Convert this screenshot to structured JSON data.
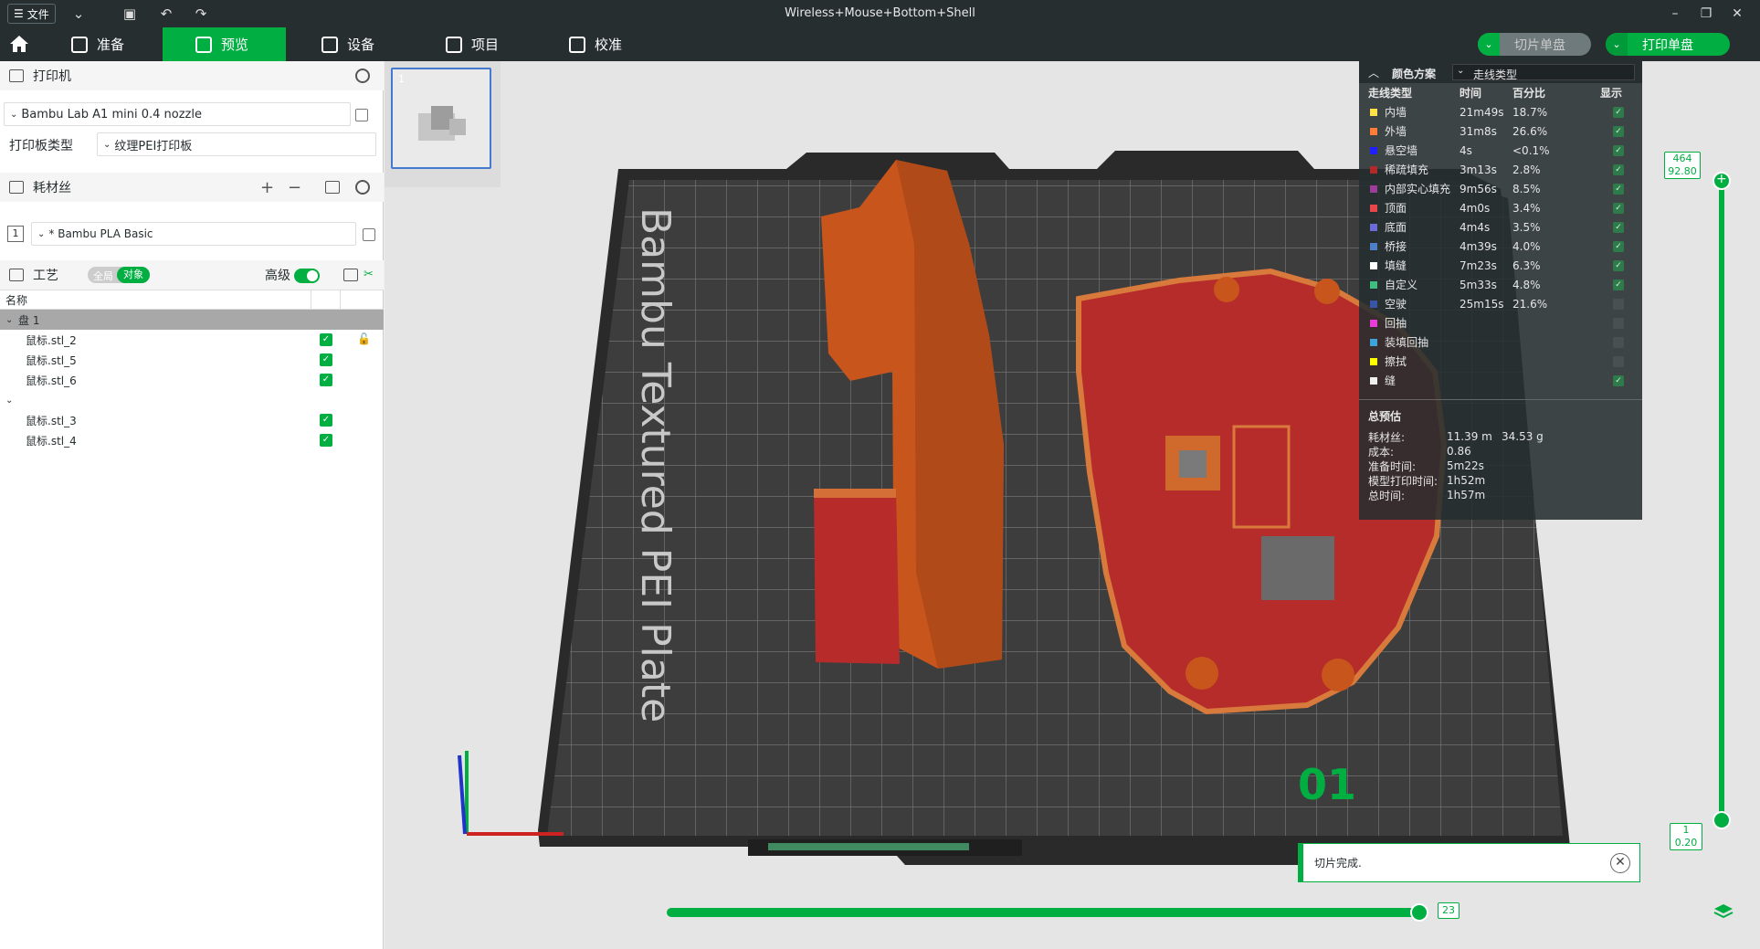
{
  "window": {
    "title": "Wireless+Mouse+Bottom+Shell",
    "file_menu_label": "文件"
  },
  "tabs": [
    {
      "label": "准备"
    },
    {
      "label": "预览"
    },
    {
      "label": "设备"
    },
    {
      "label": "项目"
    },
    {
      "label": "校准"
    }
  ],
  "toolbar": {
    "slice_plate_label": "切片单盘",
    "print_plate_label": "打印单盘"
  },
  "printer": {
    "section_label": "打印机",
    "printer_name": "Bambu Lab A1 mini 0.4 nozzle",
    "plate_type_label": "打印板类型",
    "plate_type_value": "纹理PEI打印板"
  },
  "filament": {
    "section_label": "耗材丝",
    "slot_index": "1",
    "filament_name": "* Bambu PLA Basic"
  },
  "process": {
    "section_label": "工艺",
    "toggle_global": "全局",
    "toggle_object": "对象",
    "advanced_label": "高级"
  },
  "object_tree": {
    "column_name": "名称",
    "plate_label": "盘 1",
    "items_group1": [
      "鼠标.stl_2",
      "鼠标.stl_5",
      "鼠标.stl_6"
    ],
    "items_group2": [
      "鼠标.stl_3",
      "鼠标.stl_4"
    ]
  },
  "plate": {
    "thumbnail_index": "1",
    "bed_label": "Bambu Textured PEI Plate",
    "plate_number": "01"
  },
  "legend": {
    "color_scheme_label": "颜色方案",
    "color_scheme_value": "走线类型",
    "col_type": "走线类型",
    "col_time": "时间",
    "col_percent": "百分比",
    "col_show": "显示",
    "rows": [
      {
        "name": "内墙",
        "time": "21m49s",
        "pct": "18.7%",
        "color": "#ffe14a",
        "shown": true
      },
      {
        "name": "外墙",
        "time": "31m8s",
        "pct": "26.6%",
        "color": "#ff7d38",
        "shown": true
      },
      {
        "name": "悬空墙",
        "time": "4s",
        "pct": "<0.1%",
        "color": "#1f1fff",
        "shown": true
      },
      {
        "name": "稀疏填充",
        "time": "3m13s",
        "pct": "2.8%",
        "color": "#b3292a",
        "shown": true
      },
      {
        "name": "内部实心填充",
        "time": "9m56s",
        "pct": "8.5%",
        "color": "#9a3e9a",
        "shown": true
      },
      {
        "name": "顶面",
        "time": "4m0s",
        "pct": "3.4%",
        "color": "#e8464a",
        "shown": true
      },
      {
        "name": "底面",
        "time": "4m4s",
        "pct": "3.5%",
        "color": "#6c6cd8",
        "shown": true
      },
      {
        "name": "桥接",
        "time": "4m39s",
        "pct": "4.0%",
        "color": "#4e7ec8",
        "shown": true
      },
      {
        "name": "填缝",
        "time": "7m23s",
        "pct": "6.3%",
        "color": "#ffffff",
        "shown": true
      },
      {
        "name": "自定义",
        "time": "5m33s",
        "pct": "4.8%",
        "color": "#3fbf7f",
        "shown": true
      },
      {
        "name": "空驶",
        "time": "25m15s",
        "pct": "21.6%",
        "color": "#3a55a8",
        "shown": false
      },
      {
        "name": "回抽",
        "time": "",
        "pct": "",
        "color": "#e93cd6",
        "shown": false
      },
      {
        "name": "装填回抽",
        "time": "",
        "pct": "",
        "color": "#3fa2d8",
        "shown": false
      },
      {
        "name": "擦拭",
        "time": "",
        "pct": "",
        "color": "#ffff00",
        "shown": false
      },
      {
        "name": "缝",
        "time": "",
        "pct": "",
        "color": "#f0f0f0",
        "shown": true
      }
    ],
    "summary_title": "总预估",
    "summary": [
      {
        "label": "耗材丝:",
        "value": "11.39 m",
        "extra": "34.53 g"
      },
      {
        "label": "成本:",
        "value": "0.86",
        "extra": ""
      },
      {
        "label": "准备时间:",
        "value": "5m22s",
        "extra": ""
      },
      {
        "label": "模型打印时间:",
        "value": "1h52m",
        "extra": ""
      },
      {
        "label": "总时间:",
        "value": "1h57m",
        "extra": ""
      }
    ]
  },
  "layer_slider": {
    "top_layer": "464",
    "top_height": "92.80",
    "bottom_layer": "1",
    "bottom_height": "0.20"
  },
  "move_slider": {
    "value": "23"
  },
  "toast": {
    "message": "切片完成."
  }
}
